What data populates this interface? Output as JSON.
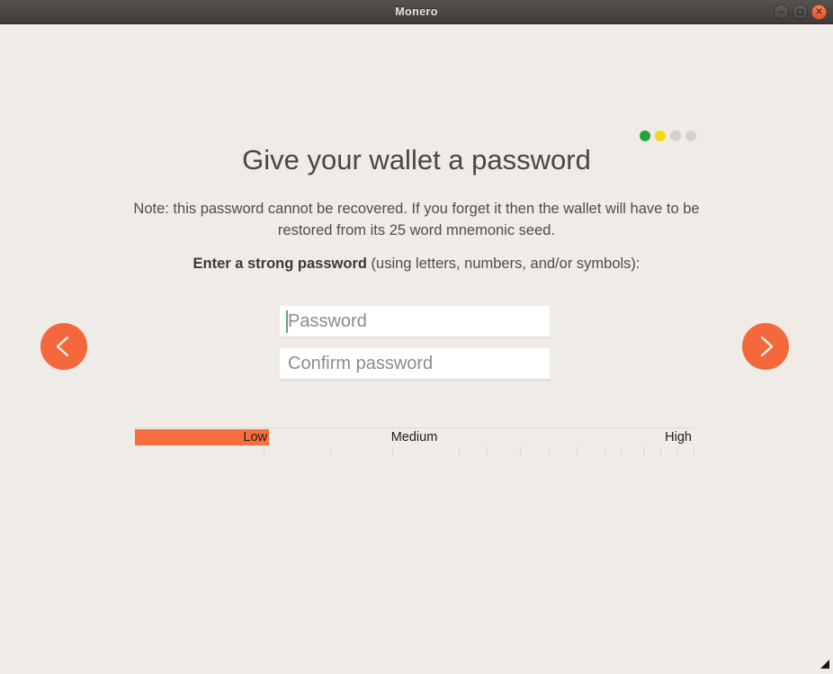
{
  "window": {
    "title": "Monero",
    "controls": [
      {
        "name": "minimize-button",
        "glyph": "minimize-icon"
      },
      {
        "name": "maximize-button",
        "glyph": "maximize-icon"
      },
      {
        "name": "close-button",
        "glyph": "close-icon"
      }
    ]
  },
  "wizard": {
    "steps": [
      {
        "state": "complete",
        "color": "#26a33d"
      },
      {
        "state": "current",
        "color": "#f4d712"
      },
      {
        "state": "upcoming",
        "color": "#d4d0cc"
      },
      {
        "state": "upcoming",
        "color": "#d4d0cc"
      }
    ],
    "headline": "Give your wallet a password",
    "note": "Note: this password cannot be recovered. If you forget it then the wallet will have to be restored from its 25 word mnemonic seed.",
    "instruction_bold": "Enter a strong password",
    "instruction_regular": " (using letters, numbers, and/or symbols):",
    "prev_button": "previous-step-arrow",
    "next_button": "next-step-arrow"
  },
  "form": {
    "password": {
      "value": "",
      "placeholder": "Password"
    },
    "confirm": {
      "value": "",
      "placeholder": "Confirm password"
    }
  },
  "strength_meter": {
    "labels": {
      "low": "Low",
      "medium": "Medium",
      "high": "High"
    },
    "fill_percent": 24,
    "fill_color": "#f96e3f",
    "tick_positions": [
      23,
      35,
      46,
      58,
      63,
      69,
      74,
      79,
      84,
      87,
      91,
      94,
      97,
      100
    ]
  },
  "colors": {
    "background": "#efebe7",
    "accent": "#f4683c",
    "titlebar": "#4b4846",
    "text": "#4f4d4b"
  }
}
